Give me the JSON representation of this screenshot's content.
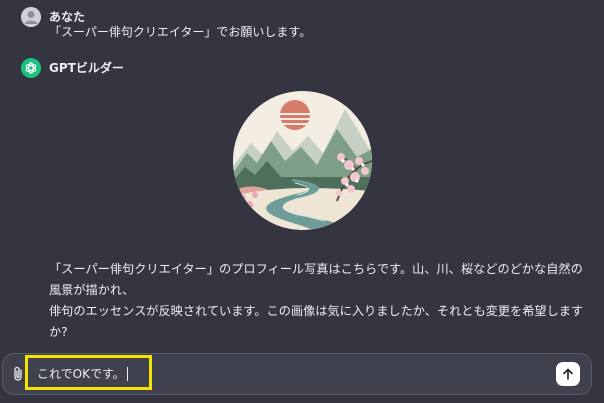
{
  "conversation": {
    "user_message": {
      "author": "あなた",
      "text": "「スーパー俳句クリエイター」でお願いします。"
    },
    "assistant_message": {
      "author": "GPTビルダー",
      "image_alt": "山、川、桜などの自然の風景",
      "reply_line1": "「スーパー俳句クリエイター」のプロフィール写真はこちらです。山、川、桜などのどかな自然の風景が描かれ、",
      "reply_line2": "俳句のエッセンスが反映されています。この画像は気に入りましたか、それとも変更を希望しますか?"
    }
  },
  "composer": {
    "input_value": "これでOKです。",
    "attach_icon": "paperclip-icon",
    "send_icon": "arrow-up-icon"
  },
  "colors": {
    "background": "#343541",
    "composer_bg": "#40414f",
    "highlight": "#f5e400",
    "gpt_avatar": "#19c37d"
  }
}
